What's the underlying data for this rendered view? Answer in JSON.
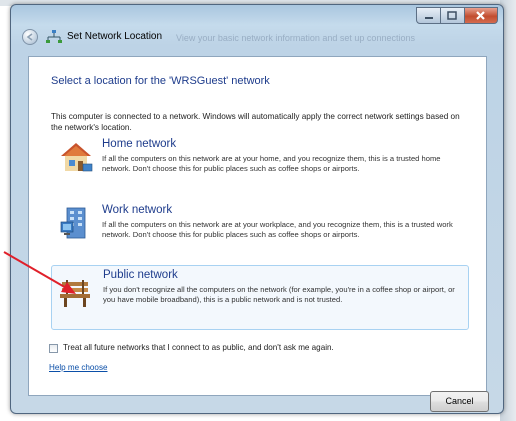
{
  "window": {
    "title": "Set Network Location",
    "background_text": "View your basic network information and set up connections"
  },
  "dialog": {
    "heading": "Select a location for the 'WRSGuest' network",
    "intro": "This computer is connected to a network. Windows will automatically apply the correct network settings based on the network's location.",
    "options": [
      {
        "icon": "home-network-icon",
        "title": "Home network",
        "description": "If all the computers on this network are at your home, and you recognize them, this is a trusted home network.  Don't choose this for public places such as coffee shops or airports.",
        "selected": false
      },
      {
        "icon": "work-network-icon",
        "title": "Work network",
        "description": "If all the computers on this network are at your workplace, and you recognize them, this is a trusted work network.  Don't choose this for public places such as coffee shops or airports.",
        "selected": false
      },
      {
        "icon": "public-network-icon",
        "title": "Public network",
        "description": "If you don't recognize all the computers on the network (for example, you're in a coffee shop or airport, or you have mobile broadband), this is a public network and is not trusted.",
        "selected": true
      }
    ],
    "checkbox_label": "Treat all future networks that I connect to as public, and don't ask me again.",
    "checkbox_checked": false,
    "help_link": "Help me choose",
    "cancel_label": "Cancel"
  },
  "colors": {
    "link": "#0b4fa8",
    "heading": "#1e3c8c",
    "arrow": "#e0202a",
    "selection_border": "#a8d2f2"
  }
}
